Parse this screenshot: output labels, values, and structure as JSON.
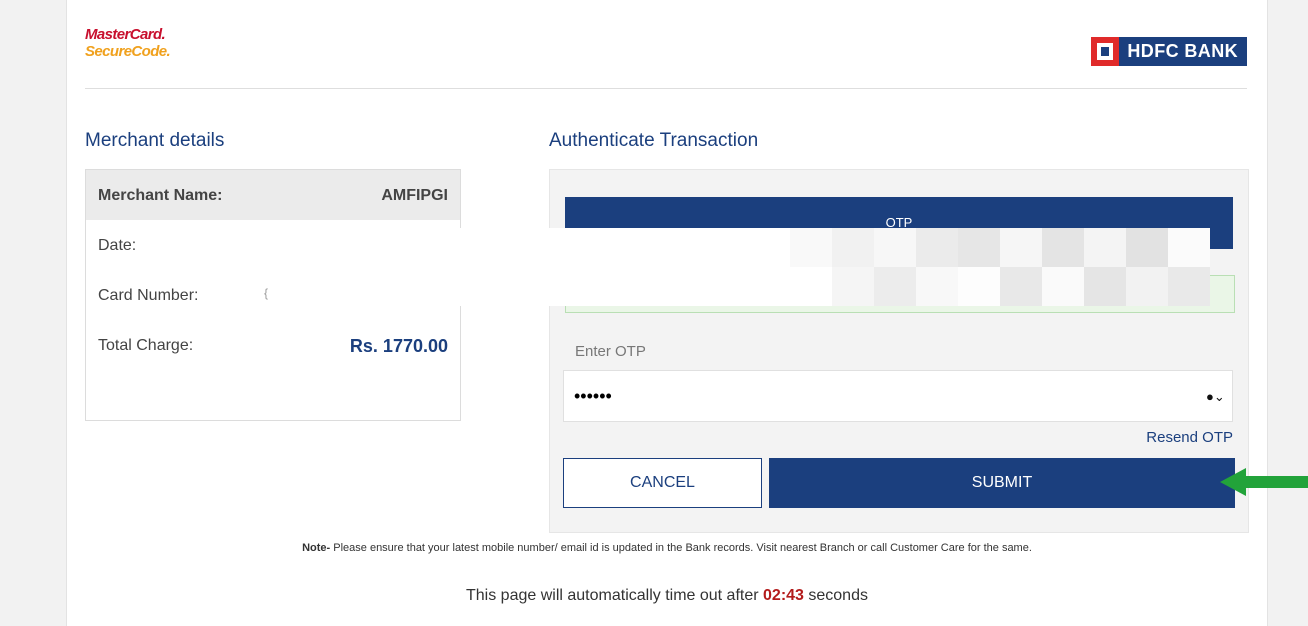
{
  "header": {
    "mastercard_line1": "MasterCard.",
    "mastercard_line2": "SecureCode.",
    "bank_name": "HDFC BANK"
  },
  "merchant": {
    "title": "Merchant details",
    "name_label": "Merchant Name:",
    "name_value": "AMFIPGI",
    "date_label": "Date:",
    "card_label": "Card Number:",
    "card_value": "{",
    "total_label": "Total Charge:",
    "total_value": "Rs. 1770.00"
  },
  "auth": {
    "title": "Authenticate Transaction",
    "otp_bar_label": "OTP",
    "enter_otp_label": "Enter OTP",
    "otp_value": "••••••",
    "resend_label": "Resend OTP",
    "cancel_label": "CANCEL",
    "submit_label": "SUBMIT"
  },
  "note": {
    "prefix": "Note-",
    "text": " Please ensure that your latest mobile number/ email id is updated in the Bank records. Visit nearest Branch or call Customer Care for the same."
  },
  "timeout": {
    "before": "This page will automatically time out after ",
    "countdown": "02:43",
    "after": " seconds"
  },
  "colors": {
    "brand_blue": "#1b3f7e",
    "hdfc_red": "#e02a2a",
    "countdown_red": "#b31b1b",
    "arrow_green": "#22a33a"
  }
}
